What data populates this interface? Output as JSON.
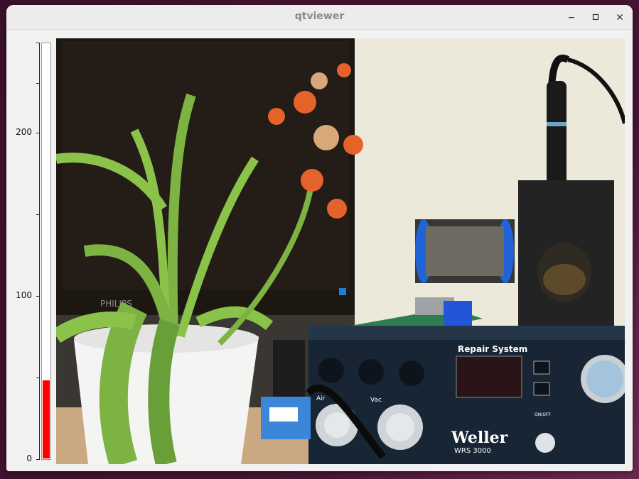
{
  "window": {
    "title": "qtviewer",
    "controls": {
      "minimize": "–",
      "maximize": "☐",
      "close": "✕"
    }
  },
  "level_meter": {
    "ticks": [
      "200",
      "100",
      "0"
    ],
    "value": 47,
    "max": 250,
    "fill_color": "#ff0000"
  },
  "camera_view": {
    "labels": {
      "station_brand": "Repair System",
      "brand": "Weller",
      "model": "WRS 3000",
      "air": "Air",
      "vac": "Vac",
      "monitor": "PHILIPS",
      "onoff": "ON/OFF"
    },
    "colors": {
      "wall": "#e9e4d6",
      "monitor": "#1c1612",
      "station": "#162433",
      "pot": "#f4f4f2",
      "leaf": "#7cb342",
      "flower": "#e0642a"
    }
  }
}
